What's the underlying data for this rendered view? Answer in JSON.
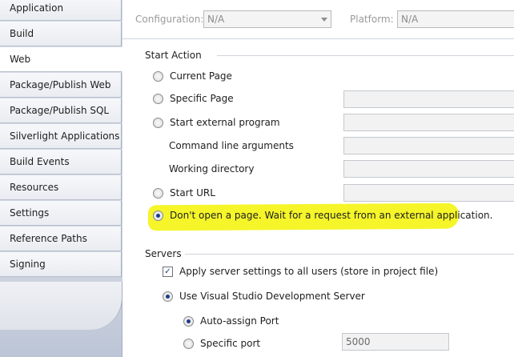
{
  "sidebar": {
    "items": [
      {
        "label": "Application",
        "active": false
      },
      {
        "label": "Build",
        "active": false
      },
      {
        "label": "Web",
        "active": true
      },
      {
        "label": "Package/Publish Web",
        "active": false
      },
      {
        "label": "Package/Publish SQL",
        "active": false
      },
      {
        "label": "Silverlight Applications",
        "active": false
      },
      {
        "label": "Build Events",
        "active": false
      },
      {
        "label": "Resources",
        "active": false
      },
      {
        "label": "Settings",
        "active": false
      },
      {
        "label": "Reference Paths",
        "active": false
      },
      {
        "label": "Signing",
        "active": false
      }
    ]
  },
  "toolbar": {
    "configuration_label": "Configuration:",
    "configuration_value": "N/A",
    "platform_label": "Platform:",
    "platform_value": "N/A"
  },
  "start_action": {
    "title": "Start Action",
    "current_page": "Current Page",
    "specific_page": "Specific Page",
    "start_external_program": "Start external program",
    "command_line_arguments": "Command line arguments",
    "working_directory": "Working directory",
    "start_url": "Start URL",
    "dont_open_page": "Don't open a page.  Wait for a request from an external application.",
    "selected": "dont_open_page"
  },
  "servers": {
    "title": "Servers",
    "apply_settings": "Apply server settings to all users (store in project file)",
    "apply_settings_checked": true,
    "use_vs_dev_server": "Use Visual Studio Development Server",
    "auto_assign_port": "Auto-assign Port",
    "specific_port": "Specific port",
    "specific_port_value": "5000"
  },
  "colors": {
    "highlight": "#f5f52a",
    "radio_dot": "#1b3c84"
  }
}
